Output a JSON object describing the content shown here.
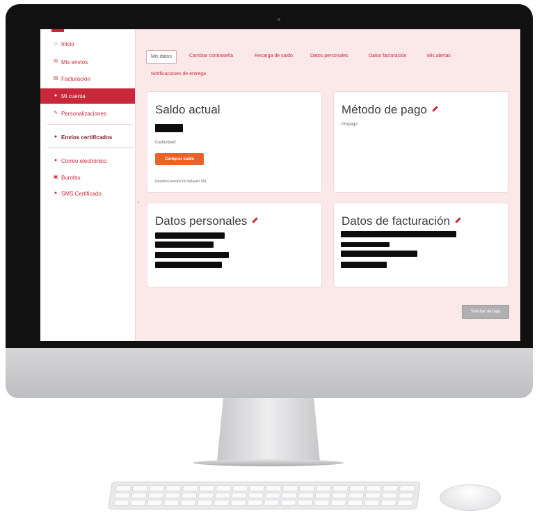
{
  "sidebar": {
    "items": [
      {
        "label": "Inicio",
        "icon": "home-icon"
      },
      {
        "label": "Mis envíos",
        "icon": "mail-icon"
      },
      {
        "label": "Facturación",
        "icon": "invoice-icon"
      },
      {
        "label": "Mi cuenta",
        "icon": "user-icon",
        "active": true
      },
      {
        "label": "Personalizaciones",
        "icon": "edit-icon"
      },
      {
        "label": "Envíos certificados",
        "icon": "certified-icon",
        "bold": true
      },
      {
        "label": "Correo electrónico",
        "icon": "email-icon"
      },
      {
        "label": "Burofax",
        "icon": "fax-icon"
      },
      {
        "label": "SMS Certificado",
        "icon": "sms-icon"
      }
    ]
  },
  "tabs": [
    {
      "label": "Mis datos",
      "active": true
    },
    {
      "label": "Cambiar contraseña"
    },
    {
      "label": "Recarga de saldo"
    },
    {
      "label": "Datos personales"
    },
    {
      "label": "Datos facturación"
    },
    {
      "label": "Mis alertas"
    },
    {
      "label": "Notificaciones de entrega"
    }
  ],
  "balance_card": {
    "title": "Saldo actual",
    "caption": "Caducidad:",
    "button_label": "Comprar saldo",
    "note": "Nuestros precios no incluyen IVA."
  },
  "payment_card": {
    "title": "Método de pago",
    "value": "Prepago"
  },
  "personal_card": {
    "title": "Datos personales"
  },
  "billing_card": {
    "title": "Datos de facturación"
  },
  "confirm_button": {
    "label": "Solicitar de baja"
  },
  "colors": {
    "accent": "#c8283a",
    "button_orange": "#e8632c",
    "content_bg": "#fbe9ea"
  }
}
